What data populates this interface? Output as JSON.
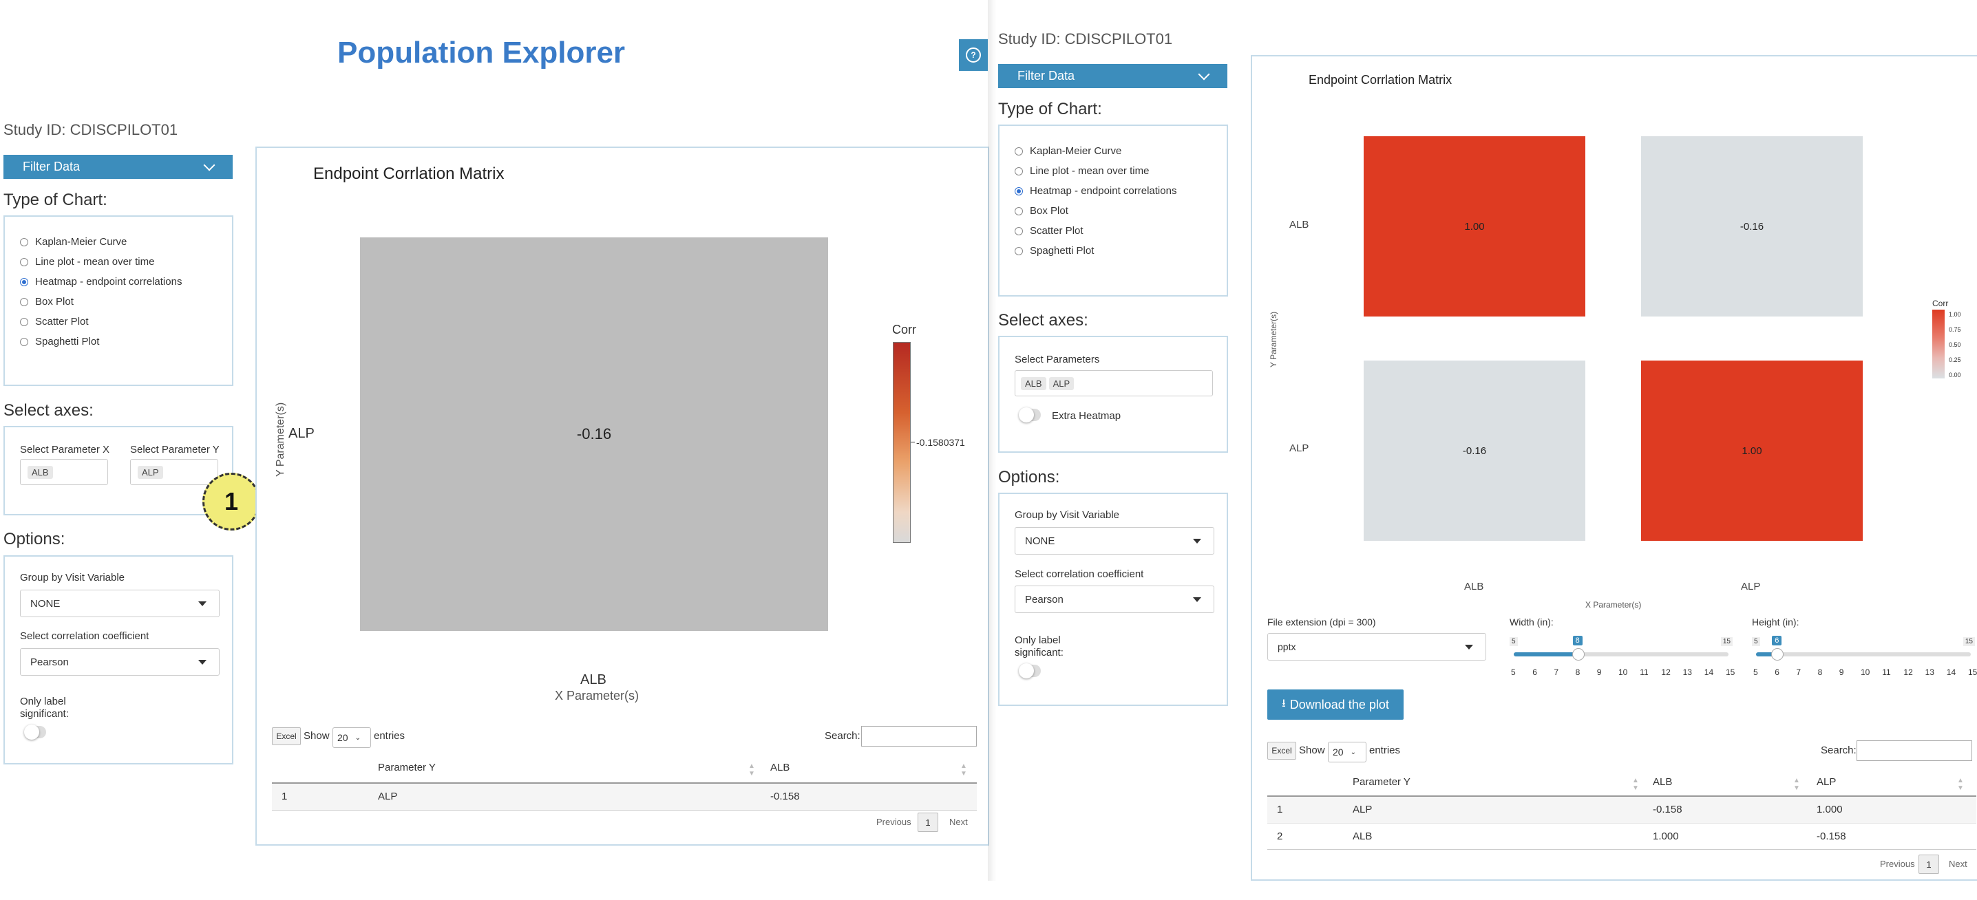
{
  "app": {
    "title": "Population Explorer",
    "help_icon": "?"
  },
  "left": {
    "study_id": "Study ID: CDISCPILOT01",
    "filter_label": "Filter Data",
    "type_heading": "Type of Chart:",
    "chart_types": [
      {
        "label": "Kaplan-Meier Curve",
        "selected": false
      },
      {
        "label": "Line plot - mean over time",
        "selected": false
      },
      {
        "label": "Heatmap - endpoint correlations",
        "selected": true
      },
      {
        "label": "Box Plot",
        "selected": false
      },
      {
        "label": "Scatter Plot",
        "selected": false
      },
      {
        "label": "Spaghetti Plot",
        "selected": false
      }
    ],
    "axes_heading": "Select axes:",
    "param_x_label": "Select Parameter X",
    "param_x_value": "ALB",
    "param_y_label": "Select Parameter Y",
    "param_y_value": "ALP",
    "options_heading": "Options:",
    "group_label": "Group by Visit Variable",
    "group_value": "NONE",
    "coef_label": "Select correlation coefficient",
    "coef_value": "Pearson",
    "only_sig_line1": "Only label",
    "only_sig_line2": "significant:",
    "marker": "1"
  },
  "left_chart": {
    "title": "Endpoint Corrlation Matrix",
    "y_label": "Y Parameter(s)",
    "x_label": "X Parameter(s)",
    "y_tick": "ALP",
    "x_tick": "ALB",
    "cell_value": "-0.16",
    "cell_color": "#bdbdbd",
    "legend_title": "Corr",
    "legend_value": "-0.1580371",
    "table": {
      "excel": "Excel",
      "show": "Show",
      "entries_value": "20",
      "entries": "entries",
      "search": "Search:",
      "headers": [
        "",
        "Parameter Y",
        "ALB"
      ],
      "rows": [
        [
          "1",
          "ALP",
          "-0.158"
        ]
      ],
      "prev": "Previous",
      "page": "1",
      "next": "Next"
    }
  },
  "right": {
    "study_id": "Study ID: CDISCPILOT01",
    "filter_label": "Filter Data",
    "type_heading": "Type of Chart:",
    "chart_types": [
      {
        "label": "Kaplan-Meier Curve",
        "selected": false
      },
      {
        "label": "Line plot - mean over time",
        "selected": false
      },
      {
        "label": "Heatmap - endpoint correlations",
        "selected": true
      },
      {
        "label": "Box Plot",
        "selected": false
      },
      {
        "label": "Scatter Plot",
        "selected": false
      },
      {
        "label": "Spaghetti Plot",
        "selected": false
      }
    ],
    "axes_heading": "Select axes:",
    "params_label": "Select Parameters",
    "params_chips": [
      "ALB",
      "ALP"
    ],
    "extra_heatmap": "Extra Heatmap",
    "options_heading": "Options:",
    "group_label": "Group by Visit Variable",
    "group_value": "NONE",
    "coef_label": "Select correlation coefficient",
    "coef_value": "Pearson",
    "only_sig_line1": "Only label",
    "only_sig_line2": "significant:"
  },
  "right_chart": {
    "title": "Endpoint Corrlation Matrix",
    "y_label": "Y Parameter(s)",
    "x_label": "X Parameter(s)",
    "y_ticks": [
      "ALB",
      "ALP"
    ],
    "x_ticks": [
      "ALB",
      "ALP"
    ],
    "cells": [
      {
        "value": "1.00",
        "color": "#de3b22"
      },
      {
        "value": "-0.16",
        "color": "#dbe0e3"
      },
      {
        "value": "-0.16",
        "color": "#dbe0e3"
      },
      {
        "value": "1.00",
        "color": "#de3b22"
      }
    ],
    "legend_title": "Corr",
    "legend_ticks": [
      "1.00",
      "0.75",
      "0.50",
      "0.25",
      "0.00"
    ],
    "file_ext_label": "File extension (dpi = 300)",
    "file_ext_value": "pptx",
    "width_label": "Width (in):",
    "width_min": "5",
    "width_max": "15",
    "width_value": "8",
    "width_fraction": 0.3,
    "height_label": "Height (in):",
    "height_min": "5",
    "height_max": "15",
    "height_value": "6",
    "height_fraction": 0.1,
    "slider_ticks": [
      "5",
      "6",
      "7",
      "8",
      "9",
      "10",
      "11",
      "12",
      "13",
      "14",
      "15"
    ],
    "download_label": "Download the plot",
    "table": {
      "excel": "Excel",
      "show": "Show",
      "entries_value": "20",
      "entries": "entries",
      "search": "Search:",
      "headers": [
        "",
        "Parameter Y",
        "ALB",
        "ALP"
      ],
      "rows": [
        [
          "1",
          "ALP",
          "-0.158",
          "1.000"
        ],
        [
          "2",
          "ALB",
          "1.000",
          "-0.158"
        ]
      ],
      "prev": "Previous",
      "page": "1",
      "next": "Next"
    }
  }
}
